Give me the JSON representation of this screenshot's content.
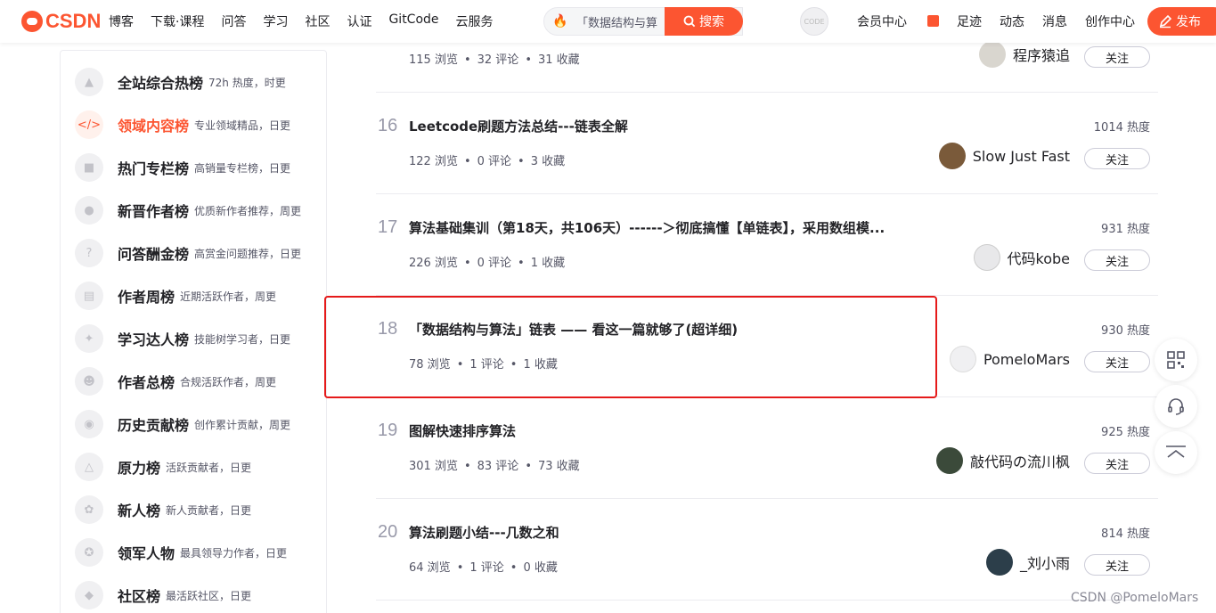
{
  "logo": {
    "text": "CSDN"
  },
  "nav": {
    "items": [
      "博客",
      "下载·课程",
      "问答",
      "学习",
      "社区",
      "认证",
      "GitCode",
      "云服务"
    ]
  },
  "search": {
    "value": "「数据结构与算",
    "button_label": "搜索"
  },
  "user_avatar": {
    "text": "CODE"
  },
  "right_nav": {
    "items": [
      "会员中心",
      "足迹",
      "动态",
      "消息",
      "创作中心"
    ],
    "publish_label": "发布"
  },
  "sidebar": {
    "items": [
      {
        "label": "全站综合热榜",
        "desc": "72h 热度，时更",
        "icon": "rocket-icon",
        "active": false
      },
      {
        "label": "领域内容榜",
        "desc": "专业领域精品，日更",
        "icon": "code-icon",
        "active": true
      },
      {
        "label": "热门专栏榜",
        "desc": "高销量专栏榜，日更",
        "icon": "book-icon",
        "active": false
      },
      {
        "label": "新晋作者榜",
        "desc": "优质新作者推荐，周更",
        "icon": "user-icon",
        "active": false
      },
      {
        "label": "问答酬金榜",
        "desc": "高赏金问题推荐，日更",
        "icon": "question-icon",
        "active": false
      },
      {
        "label": "作者周榜",
        "desc": "近期活跃作者，周更",
        "icon": "calendar-icon",
        "active": false
      },
      {
        "label": "学习达人榜",
        "desc": "技能树学习者，日更",
        "icon": "medal-icon",
        "active": false
      },
      {
        "label": "作者总榜",
        "desc": "合规活跃作者，周更",
        "icon": "group-icon",
        "active": false
      },
      {
        "label": "历史贡献榜",
        "desc": "创作累计贡献，周更",
        "icon": "camera-icon",
        "active": false
      },
      {
        "label": "原力榜",
        "desc": "活跃贡献者，日更",
        "icon": "force-icon",
        "active": false
      },
      {
        "label": "新人榜",
        "desc": "新人贡献者，日更",
        "icon": "newbie-icon",
        "active": false
      },
      {
        "label": "领军人物",
        "desc": "最具领导力作者，日更",
        "icon": "award-icon",
        "active": false
      },
      {
        "label": "社区榜",
        "desc": "最活跃社区，日更",
        "icon": "community-icon",
        "active": false
      }
    ]
  },
  "articles": [
    {
      "rank": "",
      "title": "",
      "views": "115 浏览",
      "comments": "32 评论",
      "favorites": "31 收藏",
      "heat": "",
      "author": "程序猿追",
      "follow": "关注"
    },
    {
      "rank": "16",
      "title": "Leetcode刷题方法总结---链表全解",
      "views": "122 浏览",
      "comments": "0 评论",
      "favorites": "3 收藏",
      "heat": "1014 热度",
      "author": "Slow Just Fast",
      "follow": "关注"
    },
    {
      "rank": "17",
      "title": "算法基础集训（第18天，共106天）------＞彻底搞懂【单链表】，采用数组模...",
      "views": "226 浏览",
      "comments": "0 评论",
      "favorites": "1 收藏",
      "heat": "931 热度",
      "author": "代码kobe",
      "follow": "关注"
    },
    {
      "rank": "18",
      "title": "「数据结构与算法」链表 —— 看这一篇就够了(超详细)",
      "views": "78 浏览",
      "comments": "1 评论",
      "favorites": "1 收藏",
      "heat": "930 热度",
      "author": "PomeloMars",
      "follow": "关注"
    },
    {
      "rank": "19",
      "title": "图解快速排序算法",
      "views": "301 浏览",
      "comments": "83 评论",
      "favorites": "73 收藏",
      "heat": "925 热度",
      "author": "敲代码の流川枫",
      "follow": "关注"
    },
    {
      "rank": "20",
      "title": "算法刷题小结---几数之和",
      "views": "64 浏览",
      "comments": "1 评论",
      "favorites": "0 收藏",
      "heat": "814 热度",
      "author": "_刘小雨",
      "follow": "关注"
    }
  ],
  "watermark": "CSDN @PomeloMars",
  "colors": {
    "brand": "#fc5531",
    "highlight": "#e51a1a"
  }
}
